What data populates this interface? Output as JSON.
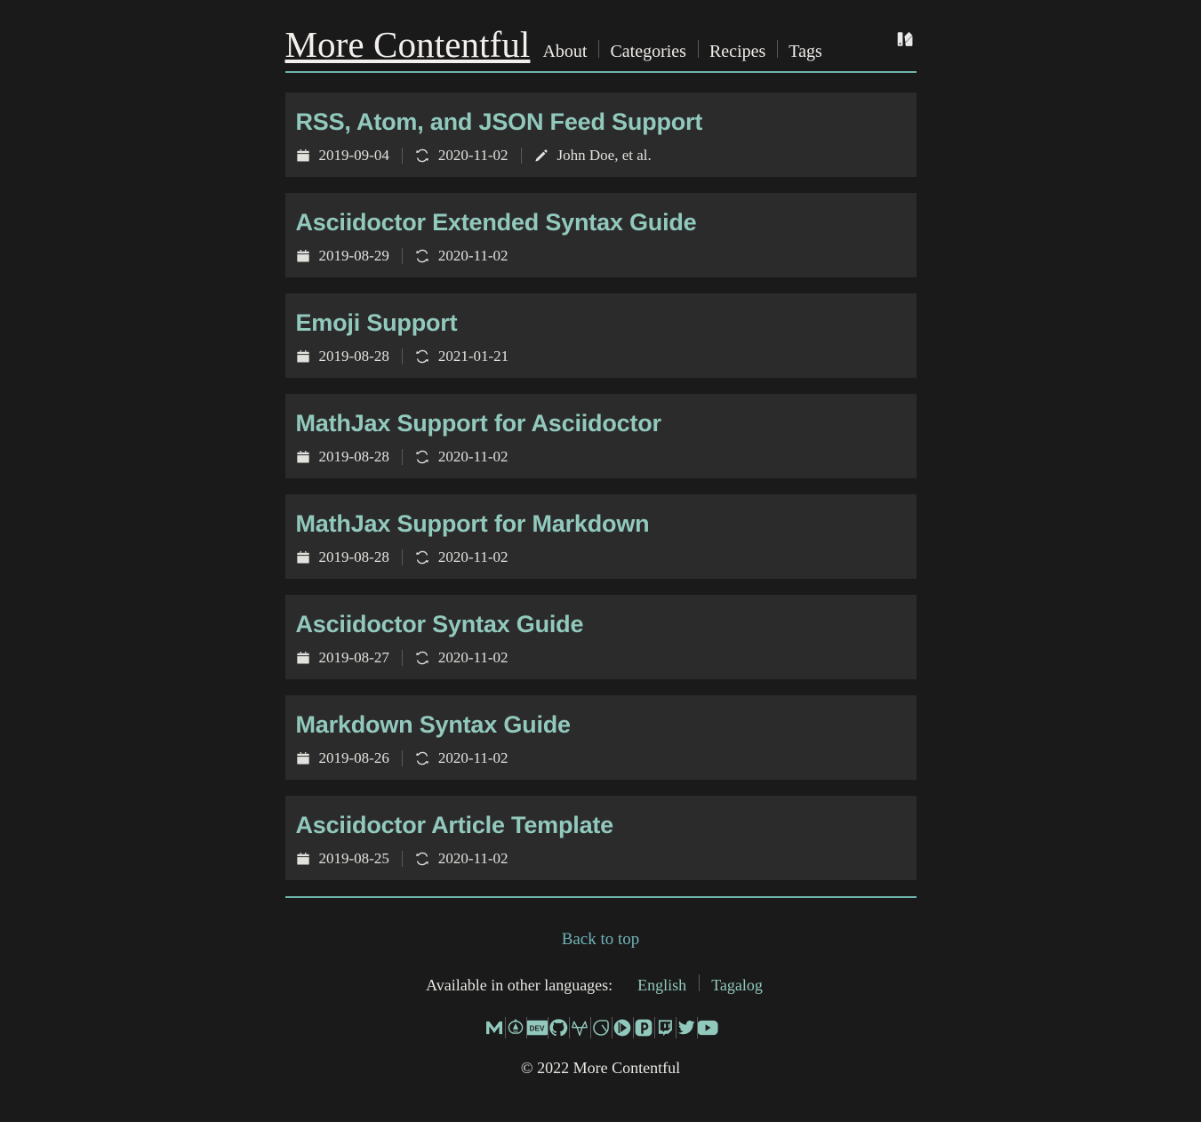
{
  "site": {
    "title": "More Contentful",
    "theme_toggle_icon": "palette-icon"
  },
  "nav": {
    "items": [
      {
        "label": "About"
      },
      {
        "label": "Categories"
      },
      {
        "label": "Recipes"
      },
      {
        "label": "Tags"
      }
    ]
  },
  "colors": {
    "background": "#1a1a1a",
    "card": "#2b2b2b",
    "accent_teal": "#92c9bd",
    "link_teal": "#6fb3b8",
    "rule": "#6fb3ae",
    "text": "#e8e6e3"
  },
  "articles": [
    {
      "title": "RSS, Atom, and JSON Feed Support",
      "published": "2019-09-04",
      "updated": "2020-11-02",
      "author": "John Doe, et al.",
      "published_icon": "calendar-icon",
      "updated_icon": "sync-icon",
      "author_icon": "pencil-icon"
    },
    {
      "title": "Asciidoctor Extended Syntax Guide",
      "published": "2019-08-29",
      "updated": "2020-11-02",
      "author": "",
      "published_icon": "calendar-icon",
      "updated_icon": "sync-icon",
      "author_icon": "pencil-icon"
    },
    {
      "title": "Emoji Support",
      "published": "2019-08-28",
      "updated": "2021-01-21",
      "author": "",
      "published_icon": "calendar-icon",
      "updated_icon": "sync-icon",
      "author_icon": "pencil-icon"
    },
    {
      "title": "MathJax Support for Asciidoctor",
      "published": "2019-08-28",
      "updated": "2020-11-02",
      "author": "",
      "published_icon": "calendar-icon",
      "updated_icon": "sync-icon",
      "author_icon": "pencil-icon"
    },
    {
      "title": "MathJax Support for Markdown",
      "published": "2019-08-28",
      "updated": "2020-11-02",
      "author": "",
      "published_icon": "calendar-icon",
      "updated_icon": "sync-icon",
      "author_icon": "pencil-icon"
    },
    {
      "title": "Asciidoctor Syntax Guide",
      "published": "2019-08-27",
      "updated": "2020-11-02",
      "author": "",
      "published_icon": "calendar-icon",
      "updated_icon": "sync-icon",
      "author_icon": "pencil-icon"
    },
    {
      "title": "Markdown Syntax Guide",
      "published": "2019-08-26",
      "updated": "2020-11-02",
      "author": "",
      "published_icon": "calendar-icon",
      "updated_icon": "sync-icon",
      "author_icon": "pencil-icon"
    },
    {
      "title": "Asciidoctor Article Template",
      "published": "2019-08-25",
      "updated": "2020-11-02",
      "author": "",
      "published_icon": "calendar-icon",
      "updated_icon": "sync-icon",
      "author_icon": "pencil-icon"
    }
  ],
  "footer": {
    "back_to_top": "Back to top",
    "languages_label": "Available in other languages:",
    "languages": [
      {
        "label": "English"
      },
      {
        "label": "Tagalog"
      }
    ],
    "socials": [
      {
        "name": "gmail-icon",
        "label": "Gmail"
      },
      {
        "name": "codeberg-icon",
        "label": "Codeberg"
      },
      {
        "name": "devto-icon",
        "label": "DEV"
      },
      {
        "name": "github-icon",
        "label": "GitHub"
      },
      {
        "name": "gitlab-icon",
        "label": "GitLab"
      },
      {
        "name": "gitea-icon",
        "label": "Gitea"
      },
      {
        "name": "peertube-icon",
        "label": "PeerTube"
      },
      {
        "name": "pixelfed-icon",
        "label": "Pixelfed"
      },
      {
        "name": "twitch-icon",
        "label": "Twitch"
      },
      {
        "name": "twitter-icon",
        "label": "Twitter"
      },
      {
        "name": "youtube-icon",
        "label": "YouTube"
      }
    ],
    "copyright": "© 2022 More Contentful"
  }
}
